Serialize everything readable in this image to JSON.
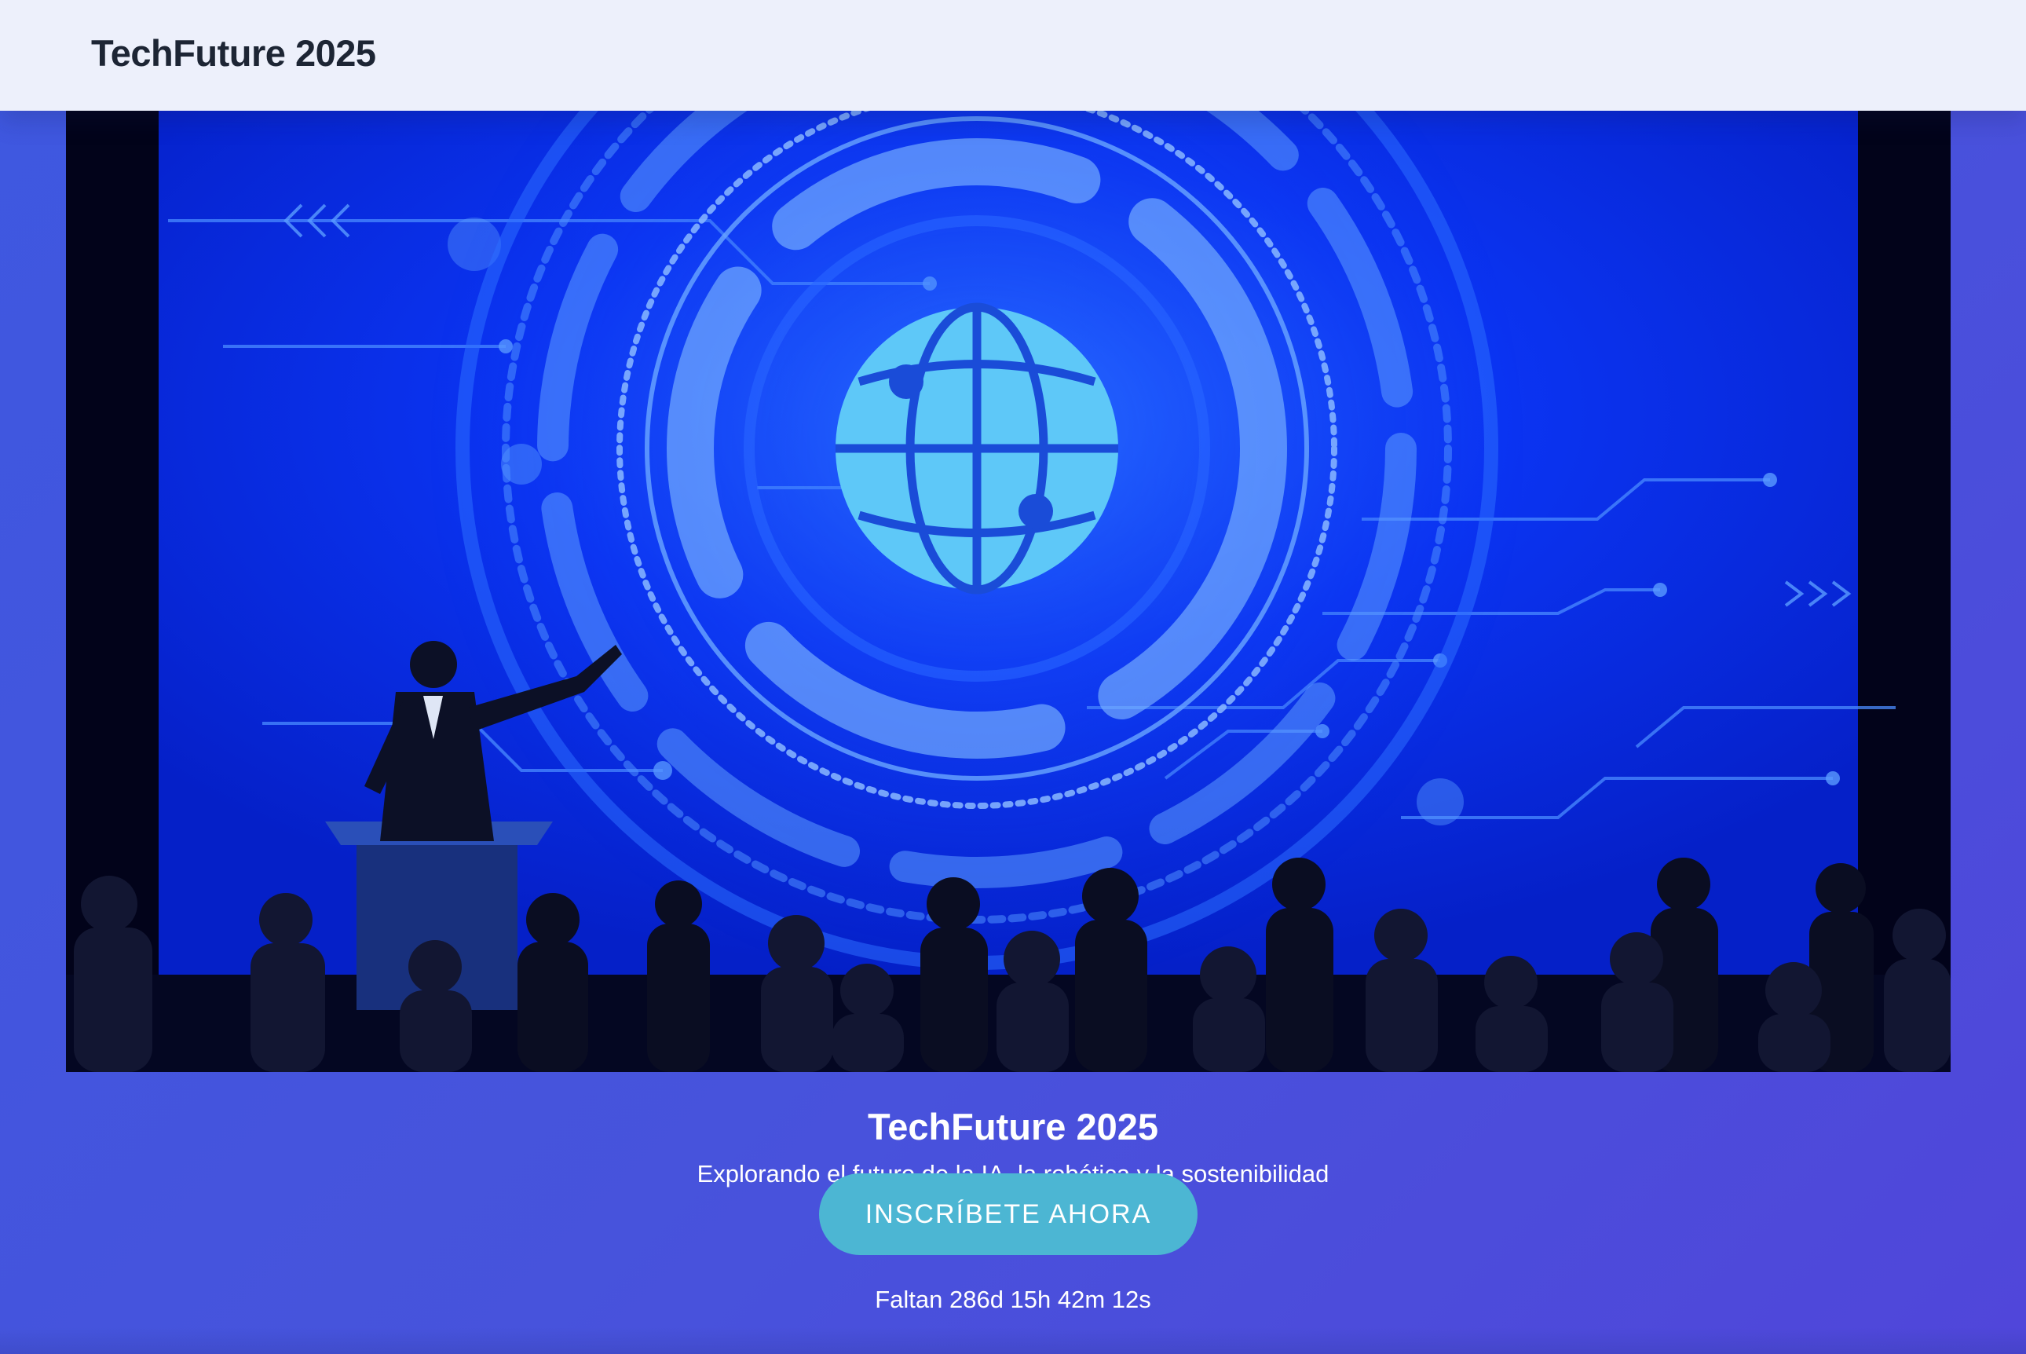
{
  "header": {
    "brand": "TechFuture 2025"
  },
  "hero": {
    "image_description": "conference-speaker-globe-stage",
    "title": "TechFuture 2025",
    "subtitle": "Explorando el futuro de la IA, la robótica y la sostenibilidad",
    "cta_label": "INSCRÍBETE AHORA",
    "countdown": "Faltan 286d 15h 42m 12s"
  },
  "colors": {
    "topbar_bg": "#edf0fb",
    "brand_text": "#1d2534",
    "page_gradient_start": "#3e58e0",
    "page_gradient_end": "#5046da",
    "cta_bg": "#4cb6d3",
    "screen_blue": "#0a2bef",
    "globe_cyan": "#5ec8f8"
  }
}
